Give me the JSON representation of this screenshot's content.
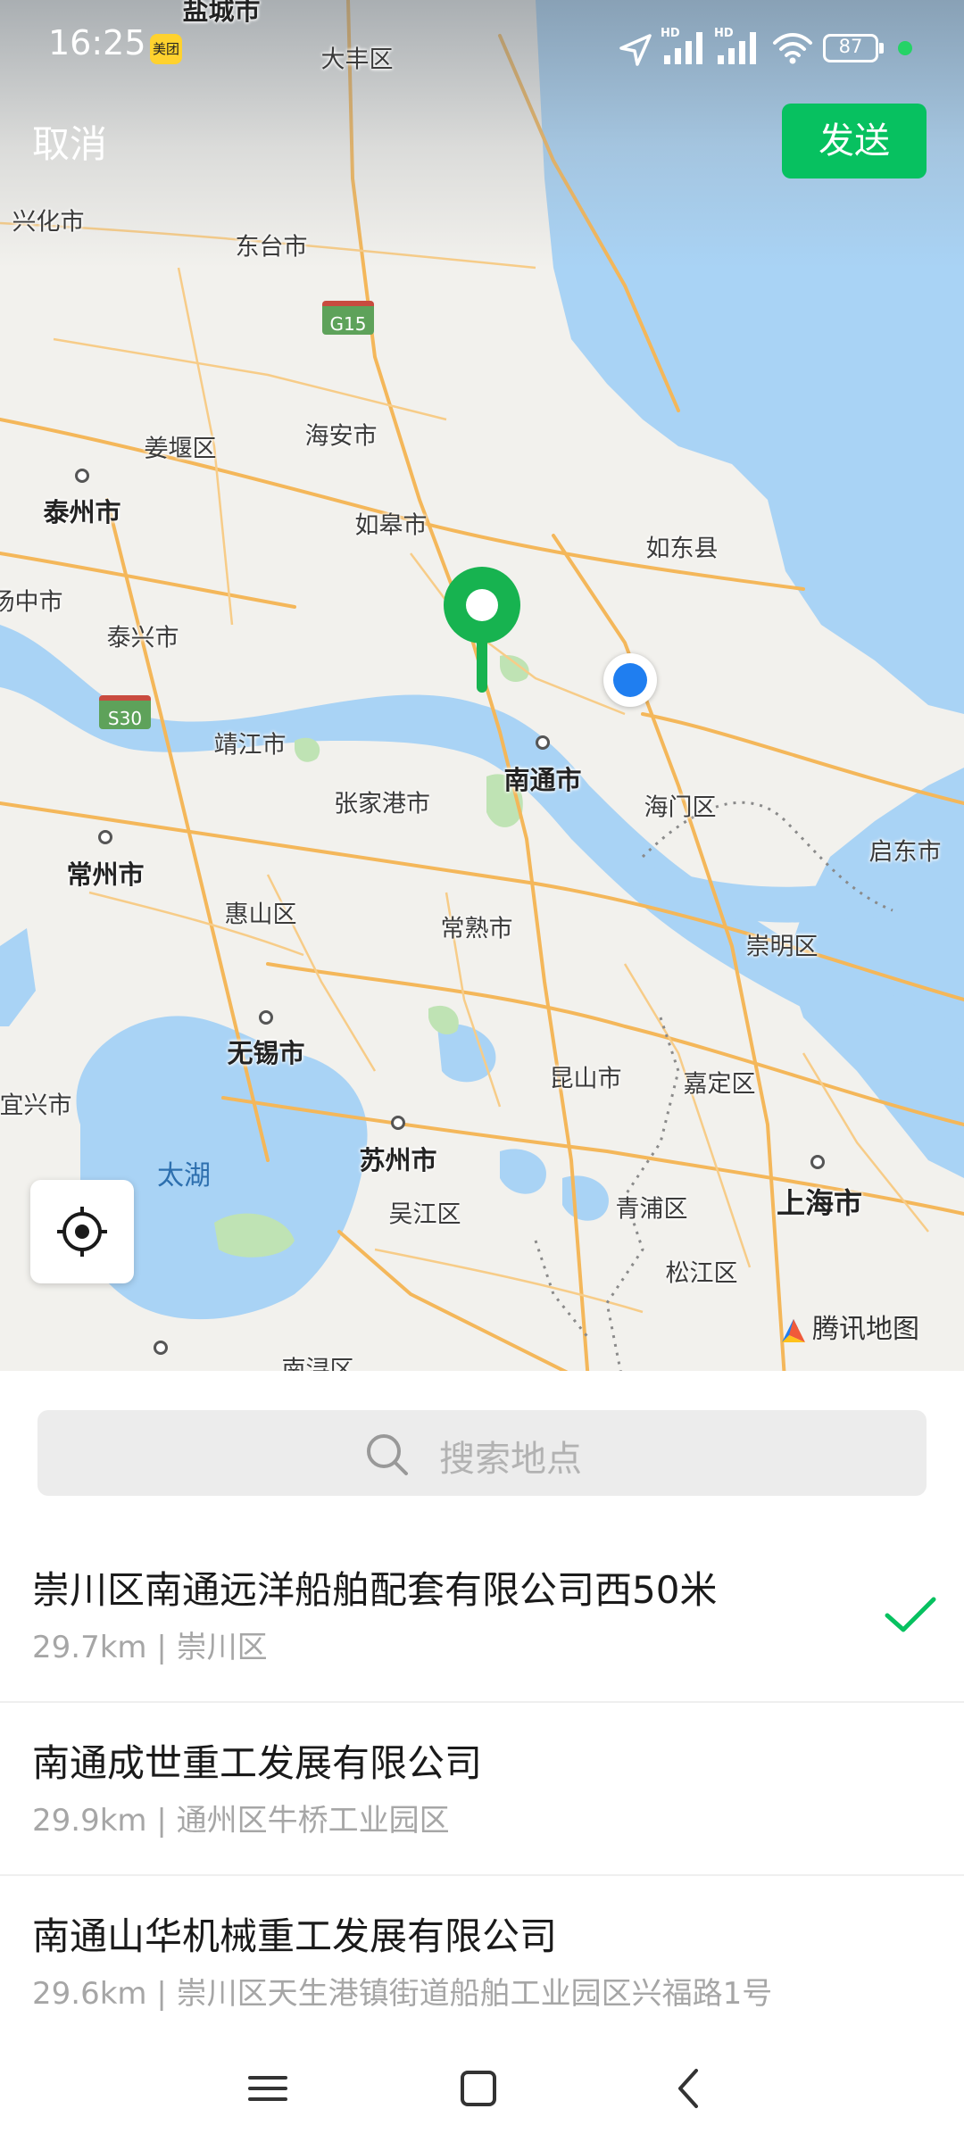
{
  "status_bar": {
    "time": "16:25",
    "app_badge": "美团",
    "network_label_1": "HD",
    "network_label_2": "HD",
    "battery": "87"
  },
  "header": {
    "cancel_label": "取消",
    "send_label": "发送"
  },
  "map": {
    "labels": {
      "yancheng": "盐城市",
      "dafeng": "大丰区",
      "xinghua": "兴化市",
      "dongtai": "东台市",
      "highway_g15": "G15",
      "haian": "海安市",
      "jiangyan": "姜堰区",
      "taizhou": "泰州市",
      "rugao": "如皋市",
      "rudong": "如东县",
      "yangzhong": "扬中市",
      "taixing": "泰兴市",
      "highway_s30": "S30",
      "jingjiang": "靖江市",
      "nantong": "南通市",
      "haimen": "海门区",
      "qidong": "启东市",
      "zhangjiagang": "张家港市",
      "changzhou": "常州市",
      "huishan": "惠山区",
      "changshu": "常熟市",
      "chongming": "崇明区",
      "wuxi": "无锡市",
      "kunshan": "昆山市",
      "jiading": "嘉定区",
      "yixing": "宜兴市",
      "taihu": "太湖",
      "suzhou": "苏州市",
      "shanghai": "上海市",
      "wujiang": "吴江区",
      "qingpu": "青浦区",
      "songjiang": "松江区",
      "nanxun": "南浔区"
    },
    "watermark": "腾讯地图",
    "colors": {
      "land": "#f2f1ed",
      "water": "#a9d3f5",
      "road": "#f4b75a",
      "green": "#bfe3b4",
      "pin": "#17b350",
      "my_location": "#1f7ef0"
    }
  },
  "search": {
    "placeholder": "搜索地点"
  },
  "results": [
    {
      "name": "崇川区南通远洋船舶配套有限公司西50米",
      "distance": "29.7km",
      "address": "崇川区",
      "selected": true
    },
    {
      "name": "南通成世重工发展有限公司",
      "distance": "29.9km",
      "address": "通州区牛桥工业园区",
      "selected": false
    },
    {
      "name": "南通山华机械重工发展有限公司",
      "distance": "29.6km",
      "address": "崇川区天生港镇街道船舶工业园区兴福路1号",
      "selected": false
    }
  ],
  "accent_color": "#07c160"
}
